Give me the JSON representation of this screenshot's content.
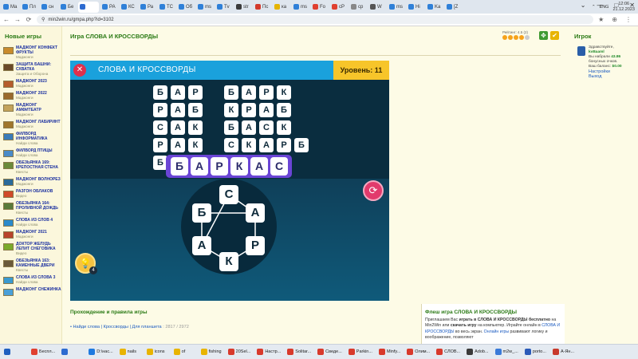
{
  "browser": {
    "tabs": [
      {
        "label": "Ma",
        "color": "#2f80d8"
      },
      {
        "label": "Пл",
        "color": "#2f80d8"
      },
      {
        "label": "сн",
        "color": "#2f80d8"
      },
      {
        "label": "Бе",
        "color": "#2f80d8"
      },
      {
        "label": "",
        "color": "#2d6bd0",
        "active": true
      },
      {
        "label": "РА",
        "color": "#2f80d8"
      },
      {
        "label": "КС",
        "color": "#2f80d8"
      },
      {
        "label": "Ра",
        "color": "#2f80d8"
      },
      {
        "label": "ТС",
        "color": "#2f80d8"
      },
      {
        "label": "Об",
        "color": "#2f80d8"
      },
      {
        "label": "ms",
        "color": "#2f80d8"
      },
      {
        "label": "Tv",
        "color": "#2f80d8"
      },
      {
        "label": "str",
        "color": "#3b3b3b"
      },
      {
        "label": "Пс",
        "color": "#d33a2c"
      },
      {
        "label": "ка",
        "color": "#e5b400"
      },
      {
        "label": "ms",
        "color": "#2f80d8"
      },
      {
        "label": "Fo",
        "color": "#e04030"
      },
      {
        "label": "сР",
        "color": "#e04030"
      },
      {
        "label": "ср",
        "color": "#888888"
      },
      {
        "label": "W",
        "color": "#555555"
      },
      {
        "label": "ms",
        "color": "#2f80d8"
      },
      {
        "label": "Hi",
        "color": "#2f80d8"
      },
      {
        "label": "Ka",
        "color": "#2f80d8"
      },
      {
        "label": "[Z",
        "color": "#2f80d8"
      }
    ],
    "window_controls": [
      "⌄",
      "—",
      "□",
      "✕"
    ],
    "url": "min2win.ru/gmpa.php?id=3102",
    "toolbar_icons": [
      "★",
      "⊕",
      "⋮"
    ]
  },
  "left": {
    "title": "Новые игры",
    "games": [
      {
        "name": "Маджонг Конфект фрукты",
        "category": "Маджонги",
        "color": "#c98b2c"
      },
      {
        "name": "Защита башни: схватка",
        "category": "Защита и Оборона",
        "color": "#6b4a2a"
      },
      {
        "name": "Маджонг 2023",
        "category": "Маджонги",
        "color": "#b55c2c"
      },
      {
        "name": "Маджонг 2022",
        "category": "Маджонги",
        "color": "#9a6a2c"
      },
      {
        "name": "Маджонг Амфитеатр",
        "category": "Маджонги",
        "color": "#c4a35a"
      },
      {
        "name": "Маджонг Лабиринт",
        "category": "Маджонги",
        "color": "#a0762c"
      },
      {
        "name": "Филворд информатика",
        "category": "Найди слова",
        "color": "#3a7bb8"
      },
      {
        "name": "Филворд птицы",
        "category": "Найди слова",
        "color": "#4a8bc8"
      },
      {
        "name": "Обезьянка 169: крепостная стена",
        "category": "Квесты",
        "color": "#6b8a3a"
      },
      {
        "name": "Маджонг волнорез",
        "category": "Маджонги",
        "color": "#2a6a9a"
      },
      {
        "name": "Разгон облаков",
        "category": "Видео",
        "color": "#d04a2a"
      },
      {
        "name": "Обезьянка 164: проливной дождь",
        "category": "Квесты",
        "color": "#5a7a3a"
      },
      {
        "name": "Слова из слов 4",
        "category": "Найди слова",
        "color": "#2a8acb"
      },
      {
        "name": "Маджонг 2021",
        "category": "Маджонги",
        "color": "#b8442c"
      },
      {
        "name": "Доктор желудь лепит снеговика",
        "category": "Видео",
        "color": "#7aaa2a"
      },
      {
        "name": "Обезьянка 163: каменные двери",
        "category": "Квесты",
        "color": "#6a5a3a"
      },
      {
        "name": "Слова из слова 3",
        "category": "Найди слова",
        "color": "#3a9ad0"
      },
      {
        "name": "Маджонг снежинка",
        "category": "",
        "color": "#4aa0d8"
      }
    ]
  },
  "main": {
    "title": "Игра СЛОВА И КРОССВОРДЫ",
    "rating_label": "Рейтинг: 4.5 (2)",
    "stars": 4,
    "fullscreen_icon": "✥",
    "check_icon": "✔"
  },
  "game": {
    "name": "СЛОВА И КРОССВОРДЫ",
    "level_text": "Уровень: 11",
    "close_icon": "✕",
    "board_left": [
      [
        "Б",
        "А",
        "Р"
      ],
      [
        "Р",
        "А",
        "Б"
      ],
      [
        "С",
        "А",
        "К"
      ],
      [
        "Р",
        "А",
        "К"
      ],
      [
        "Б",
        "",
        ""
      ]
    ],
    "board_right": [
      [
        "Б",
        "А",
        "Р",
        "К",
        ""
      ],
      [
        "К",
        "Р",
        "А",
        "Б",
        ""
      ],
      [
        "Б",
        "А",
        "С",
        "К",
        ""
      ],
      [
        "С",
        "К",
        "А",
        "Р",
        "Б"
      ]
    ],
    "current_word": [
      "Б",
      "А",
      "Р",
      "К",
      "А",
      "С"
    ],
    "wheel_letters": [
      "С",
      "А",
      "Р",
      "К",
      "А",
      "Б"
    ],
    "shuffle_icon": "⟳",
    "hint_icon": "💡",
    "hint_count": "4"
  },
  "below": {
    "walk_title": "Прохождение и правила игры",
    "link1": "Найди слова",
    "link2": "Кроссворды",
    "link3": "Для планшета",
    "count": ": 2817 / 2972",
    "flash_title": "Флеш игра СЛОВА И КРОССВОРДЫ",
    "flash_p1": "Приглашаем Вас ",
    "flash_b1": "играть в СЛОВА И КРОССВОРДЫ бесплатно",
    "flash_p2": " на Min2Win или ",
    "flash_b2": "скачать игру",
    "flash_p3": " на компьютер. Играйте онлайн в ",
    "flash_l1": "СЛОВА И КРОССВОРДЫ",
    "flash_p4": " во весь экран. ",
    "flash_l2": "Онлайн игры",
    "flash_p5": " развивают логику и воображение, позволяют"
  },
  "right": {
    "title": "Игрок",
    "greeting": "Здравствуйте,",
    "username": "kvBaaml",
    "rank_label": "Вы набрали ",
    "rank_value": "43.86",
    "bonus": "бонусных очков.",
    "balance_label": "Ваш баланс: ",
    "balance_value": "$0.00",
    "settings": "Настройки",
    "logout": "Выход"
  },
  "taskbar": {
    "items": [
      {
        "label": "",
        "color": "#1f5fbf"
      },
      {
        "label": "Беспл...",
        "color": "#e04030"
      },
      {
        "label": "",
        "color": "#2d6bd0"
      },
      {
        "label": "D:\\нас...",
        "color": "#1f7adf"
      },
      {
        "label": "nails",
        "color": "#e8b400"
      },
      {
        "label": "icons",
        "color": "#e8b400"
      },
      {
        "label": "of",
        "color": "#e8b400"
      },
      {
        "label": "fishing",
        "color": "#e8b400"
      },
      {
        "label": "20Sel...",
        "color": "#d83a2c"
      },
      {
        "label": "Настр...",
        "color": "#d83a2c"
      },
      {
        "label": "Solitar...",
        "color": "#d83a2c"
      },
      {
        "label": "Сведе...",
        "color": "#d83a2c"
      },
      {
        "label": "Parkin...",
        "color": "#d83a2c"
      },
      {
        "label": "Minfy...",
        "color": "#d83a2c"
      },
      {
        "label": "Олим...",
        "color": "#d83a2c"
      },
      {
        "label": "СЛОВ...",
        "color": "#d83a2c"
      },
      {
        "label": "Adob...",
        "color": "#3a3a3a"
      },
      {
        "label": "m2w_...",
        "color": "#3a7ad8"
      },
      {
        "label": "porto...",
        "color": "#2a5ab8"
      },
      {
        "label": "А-Ян...",
        "color": "#c83a2c"
      }
    ],
    "lang": "ENG",
    "time": "12:06",
    "date": "21.12.2023"
  }
}
